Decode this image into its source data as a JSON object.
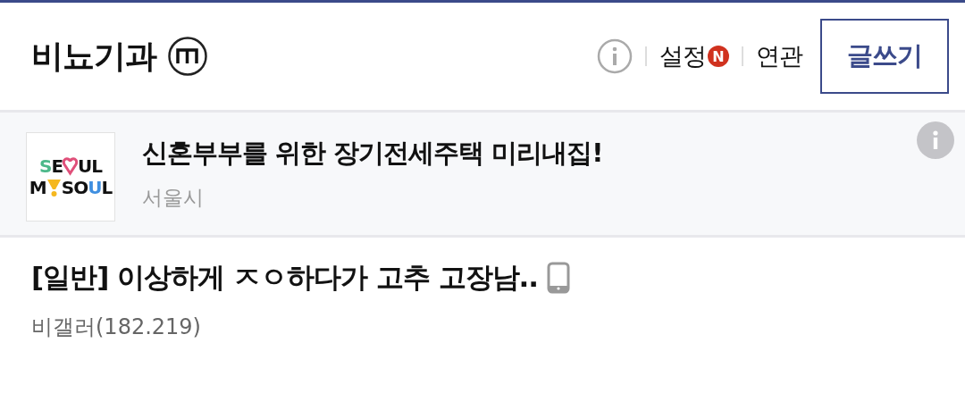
{
  "header": {
    "title": "비뇨기과",
    "settings_label": "설정",
    "settings_new": true,
    "new_badge": "N",
    "related_label": "연관",
    "write_button": "글쓰기"
  },
  "ad": {
    "logo_rows": [
      [
        {
          "kind": "text",
          "text": "S",
          "color": "#4cb88a"
        },
        {
          "kind": "text",
          "text": "E",
          "color": "#111111"
        },
        {
          "kind": "heart",
          "color": "#e0507a"
        },
        {
          "kind": "text",
          "text": "UL",
          "color": "#111111"
        }
      ],
      [
        {
          "kind": "text",
          "text": "M",
          "color": "#111111"
        },
        {
          "kind": "bang",
          "color": "#f5b820"
        },
        {
          "kind": "text",
          "text": "SO",
          "color": "#111111"
        },
        {
          "kind": "text",
          "text": "U",
          "color": "#3f8fe0"
        },
        {
          "kind": "text",
          "text": "L",
          "color": "#111111"
        }
      ]
    ],
    "headline": "신혼부부를 위한 장기전세주택 미리내집!",
    "advertiser": "서울시"
  },
  "post": {
    "title": "[일반] 이상하게 ㅈㅇ하다가 고추 고장남..",
    "mobile": true,
    "author": "비갤러(182.219)"
  }
}
